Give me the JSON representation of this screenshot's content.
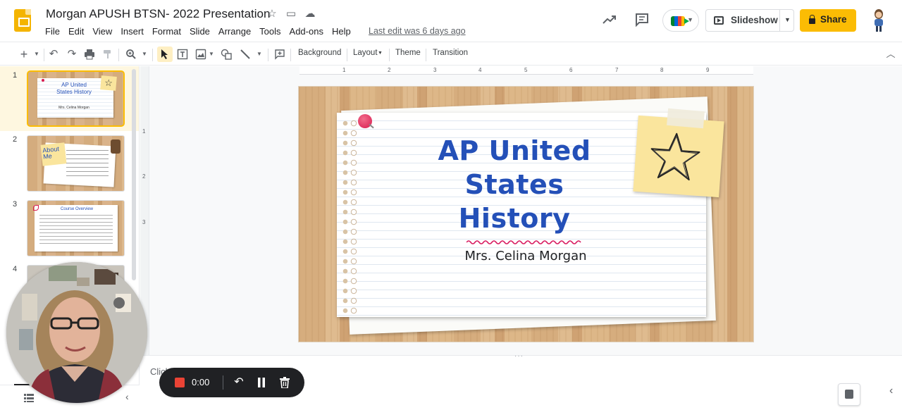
{
  "app": {
    "title": "Morgan APUSH BTSN- 2022 Presentation",
    "last_edit": "Last edit was 6 days ago"
  },
  "menu": [
    "File",
    "Edit",
    "View",
    "Insert",
    "Format",
    "Slide",
    "Arrange",
    "Tools",
    "Add-ons",
    "Help"
  ],
  "header": {
    "slideshow_label": "Slideshow",
    "share_label": "Share"
  },
  "toolbar": {
    "background_label": "Background",
    "layout_label": "Layout",
    "theme_label": "Theme",
    "transition_label": "Transition"
  },
  "ruler": {
    "ticks": [
      "1",
      "2",
      "3",
      "4",
      "5",
      "6",
      "7",
      "8",
      "9"
    ],
    "vticks": [
      "1",
      "2",
      "3"
    ]
  },
  "filmstrip": {
    "slides": [
      {
        "number": "1",
        "title": "AP United States History",
        "subtitle": "Mrs. Celina Morgan"
      },
      {
        "number": "2",
        "title": "About Me"
      },
      {
        "number": "3",
        "title": "Course Overview"
      },
      {
        "number": "4"
      }
    ]
  },
  "slide": {
    "title_line1": "AP United",
    "title_line2": "States",
    "title_line3": "History",
    "subtitle": "Mrs. Celina Morgan"
  },
  "notes": {
    "placeholder": "Click to add speaker notes"
  },
  "recorder": {
    "time": "0:00"
  },
  "colors": {
    "accent": "#fbbc04",
    "title_blue": "#2450b8",
    "record_red": "#ea4335"
  }
}
